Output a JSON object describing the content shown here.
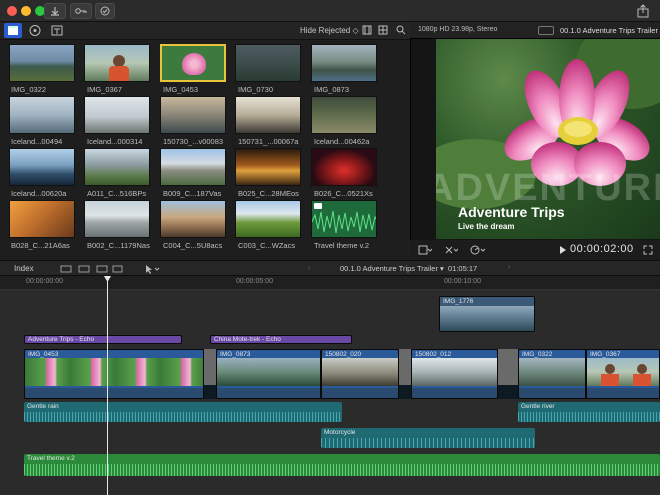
{
  "browser": {
    "filter_label": "Hide Rejected ◇",
    "clips": [
      {
        "label": "IMG_0322"
      },
      {
        "label": "IMG_0367"
      },
      {
        "label": "IMG_0453"
      },
      {
        "label": "IMG_0730"
      },
      {
        "label": "IMG_0873"
      },
      {
        "label": "Iceland...00494"
      },
      {
        "label": "Iceland...000314"
      },
      {
        "label": "150730_...v00083"
      },
      {
        "label": "150731_...00067a"
      },
      {
        "label": "Iceland...00462a"
      },
      {
        "label": "Iceland...00620a"
      },
      {
        "label": "A011_C...516BPs"
      },
      {
        "label": "B009_C...187Vas"
      },
      {
        "label": "B025_C...28MEos"
      },
      {
        "label": "B026_C...0521Xs"
      },
      {
        "label": "B028_C...21A6as"
      },
      {
        "label": "B002_C...1179Nas"
      },
      {
        "label": "C004_C...5U8acs"
      },
      {
        "label": "C003_C...WZacs"
      },
      {
        "label": "Travel theme v.2"
      }
    ]
  },
  "viewer": {
    "format": "1080p HD 23.98p, Stereo",
    "project_title": "00.1.0 Adventure Trips Trailer",
    "overlay_title": "Adventure Trips",
    "overlay_subtitle": "Live the dream",
    "watermark": "ADVENTURE",
    "timecode": "00:00:02:00"
  },
  "timeline": {
    "index_label": "Index",
    "project_name": "00.1.0 Adventure Trips Trailer ▾",
    "duration": "01:05:17",
    "ruler": [
      "00:00:00:00",
      "00:00:05:00",
      "00:00:10:00"
    ],
    "connected_clip": "IMG_1776",
    "titles": [
      {
        "name": "Adventure Trips - Echo"
      },
      {
        "name": "China Mote-trek - Echo"
      }
    ],
    "primary_clips": [
      {
        "name": "IMG_0453"
      },
      {
        "name": "IMG_0873"
      },
      {
        "name": "150802_020"
      },
      {
        "name": "150802_012"
      },
      {
        "name": "IMG_0322"
      },
      {
        "name": "IMG_0367"
      }
    ],
    "audio_clips": [
      {
        "name": "Gentle rain"
      },
      {
        "name": "Gentle river"
      },
      {
        "name": "Motorcycle"
      },
      {
        "name": "Travel theme v.2"
      }
    ]
  }
}
